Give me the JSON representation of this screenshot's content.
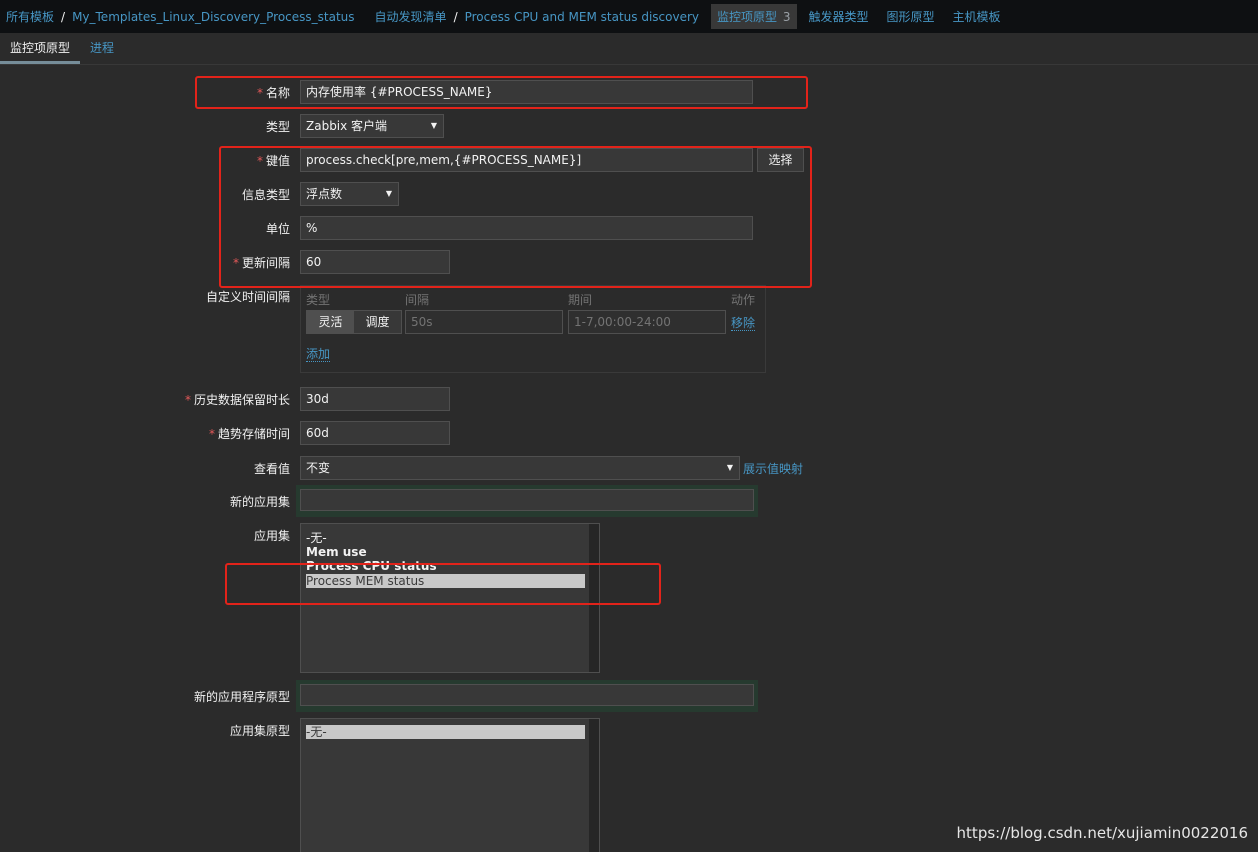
{
  "breadcrumb": {
    "all_templates": "所有模板",
    "template_name": "My_Templates_Linux_Discovery_Process_status",
    "discovery_list": "自动发现清单",
    "discovery_rule": "Process CPU and MEM status discovery",
    "item_prototypes": "监控项原型",
    "item_prototypes_count": "3",
    "trigger_types": "触发器类型",
    "graph_prototypes": "图形原型",
    "host_templates": "主机模板"
  },
  "tabs": {
    "item_prototype": "监控项原型",
    "process": "进程"
  },
  "form": {
    "required_mark": "*",
    "name_label": "名称",
    "name_value": "内存使用率 {#PROCESS_NAME}",
    "type_label": "类型",
    "type_value": "Zabbix 客户端",
    "key_label": "键值",
    "key_value": "process.check[pre,mem,{#PROCESS_NAME}]",
    "select_button": "选择",
    "info_type_label": "信息类型",
    "info_type_value": "浮点数",
    "units_label": "单位",
    "units_value": "%",
    "interval_label": "更新间隔",
    "interval_value": "60",
    "custom_intervals_label": "自定义时间间隔",
    "custom_intervals": {
      "col_type": "类型",
      "col_interval": "间隔",
      "col_period": "期间",
      "col_action": "动作",
      "flexible": "灵活",
      "scheduling": "调度",
      "interval_placeholder": "50s",
      "period_placeholder": "1-7,00:00-24:00",
      "remove": "移除",
      "add": "添加"
    },
    "history_label": "历史数据保留时长",
    "history_value": "30d",
    "trends_label": "趋势存储时间",
    "trends_value": "60d",
    "show_value_label": "查看值",
    "show_value_value": "不变",
    "show_value_mappings": "展示值映射",
    "new_application_label": "新的应用集",
    "applications_label": "应用集",
    "applications": [
      "-无-",
      "Mem use",
      "Process CPU status",
      "Process MEM status"
    ],
    "new_application_prototype_label": "新的应用程序原型",
    "application_prototypes_label": "应用集原型",
    "application_prototypes": [
      "-无-"
    ]
  },
  "watermark": "https://blog.csdn.net/xujiamin0022016",
  "colors": {
    "background": "#2b2b2b",
    "link": "#4796c4",
    "highlight_box": "#e2231a",
    "required": "#e45959"
  }
}
